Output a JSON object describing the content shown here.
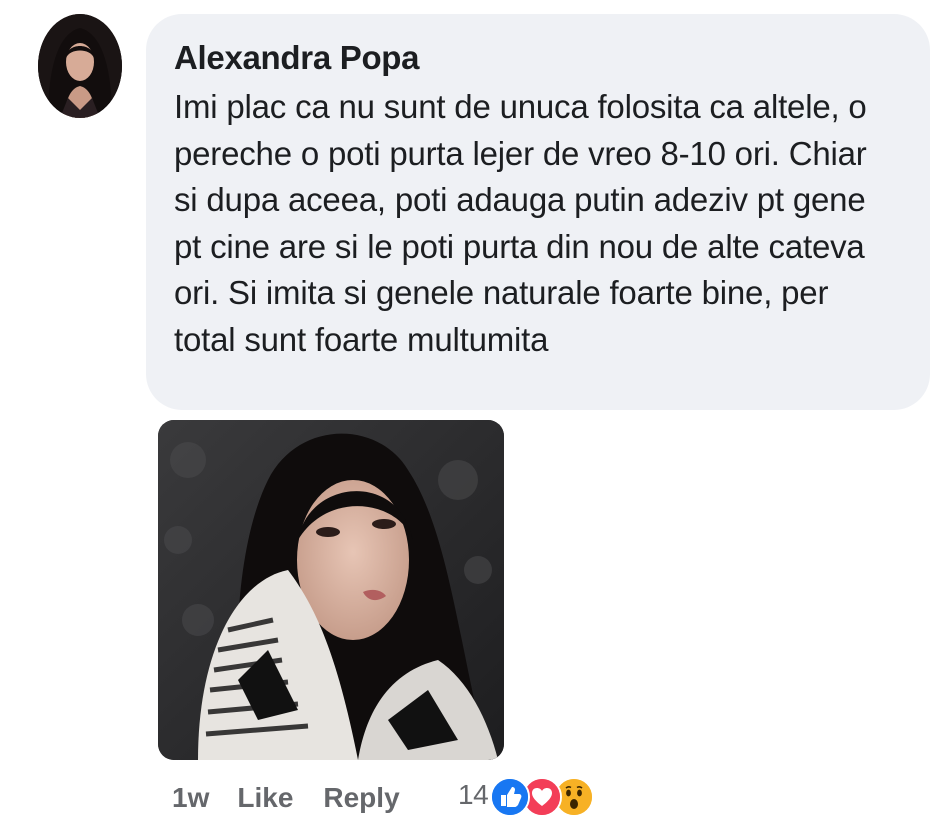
{
  "comment": {
    "author": "Alexandra Popa",
    "text": "Imi plac ca nu sunt de unuca folosita ca altele, o pereche o poti purta lejer de vreo 8-10 ori. Chiar si dupa aceea, poti adauga putin adeziv pt gene pt cine are si le poti purta din nou de alte cateva ori. Si imita si genele naturale foarte bine, per total sunt foarte multumita"
  },
  "actions": {
    "timestamp": "1w",
    "like_label": "Like",
    "reply_label": "Reply"
  },
  "reactions": {
    "count": "14",
    "icons": [
      "like-icon",
      "love-icon",
      "wow-icon"
    ]
  },
  "colors": {
    "bubble_bg": "#eff1f5",
    "text": "#1c1e21",
    "secondary_text": "#65676b",
    "like_blue": "#1877f2",
    "love_red": "#f33e58",
    "wow_yellow": "#f7b125"
  }
}
